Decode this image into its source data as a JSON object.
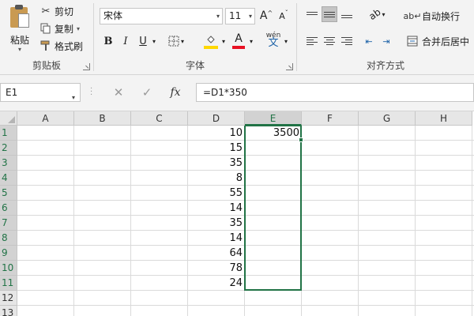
{
  "ribbon": {
    "clipboard": {
      "paste_label": "粘贴",
      "cut_label": "剪切",
      "copy_label": "复制",
      "format_painter_label": "格式刷",
      "group_label": "剪贴板"
    },
    "font": {
      "font_name": "宋体",
      "font_size": "11",
      "increase_size": "A",
      "decrease_size": "A",
      "bold": "B",
      "italic": "I",
      "underline": "U",
      "phonetic_top": "wén",
      "phonetic_char": "文",
      "group_label": "字体"
    },
    "alignment": {
      "wrap_text_label": "自动换行",
      "merge_center_label": "合并后居中",
      "group_label": "对齐方式"
    }
  },
  "formula_bar": {
    "name_box": "E1",
    "formula": "=D1*350",
    "fx_label": "fx"
  },
  "grid": {
    "columns": [
      "A",
      "B",
      "C",
      "D",
      "E",
      "F",
      "G",
      "H"
    ],
    "rows": [
      "1",
      "2",
      "3",
      "4",
      "5",
      "6",
      "7",
      "8",
      "9",
      "10",
      "11",
      "12",
      "13"
    ],
    "active_column": "E",
    "column_d_values": [
      "10",
      "15",
      "35",
      "8",
      "55",
      "14",
      "35",
      "14",
      "64",
      "78",
      "24"
    ],
    "column_e_values": [
      "3500"
    ]
  },
  "colors": {
    "accent": "#217346",
    "highlight": "#ffd800",
    "font_color": "#e81123"
  }
}
